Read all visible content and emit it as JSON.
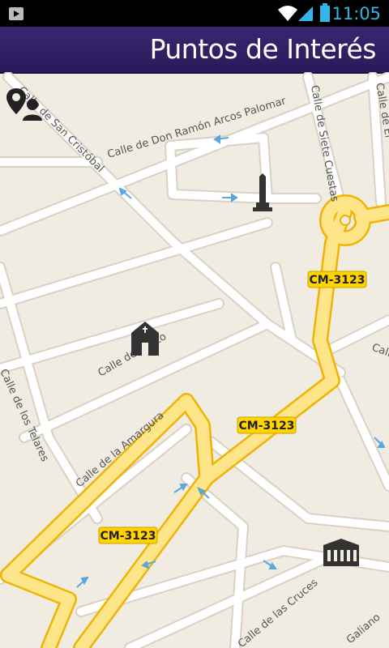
{
  "status_bar": {
    "time": "11:05",
    "icons": [
      "play-store-icon",
      "wifi-icon",
      "signal-icon",
      "battery-icon"
    ]
  },
  "app_bar": {
    "title": "Puntos de Interés",
    "color": "#34226a"
  },
  "map": {
    "streets": [
      "Calle de San Cristóbal",
      "Calle de Don Ramón Arcos Palomar",
      "Calle de Siete Cuestas",
      "Calle de El",
      "Calle de Cristo",
      "Calle de la Amargura",
      "Calle de los Telares",
      "Calle",
      "Calle de las Cruces",
      "Galiano"
    ],
    "route_shields": [
      "CM-3123",
      "CM-3123",
      "CM-3123"
    ],
    "poi": [
      "obelisk-monument",
      "chapel",
      "town-hall"
    ],
    "colors": {
      "background": "#f1ece1",
      "road": "#ffffff",
      "highway": "#ffe58a",
      "highway_border": "#f0b400",
      "arrow": "#5aa7e0"
    }
  }
}
